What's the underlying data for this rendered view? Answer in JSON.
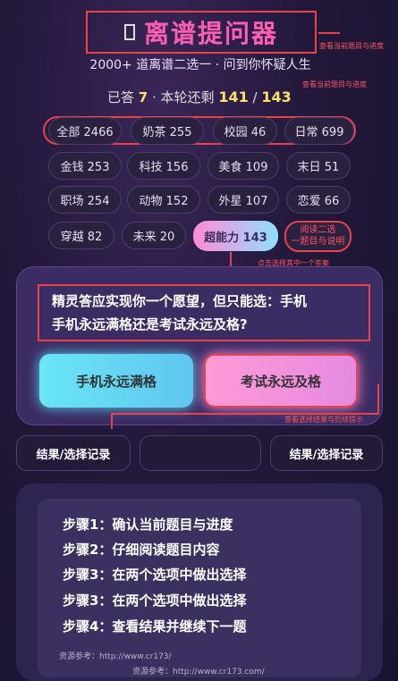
{
  "header": {
    "title_icon": "box-glyph-icon",
    "title": "离谱提问器",
    "subtitle": "2000+ 道离谱二选一 · 问到你怀疑人生"
  },
  "progress": {
    "answered_label": "已答",
    "answered": "7",
    "left_label": "· 本轮还剩",
    "left": "141",
    "sep": "/",
    "total": "143"
  },
  "annotations": {
    "a1": "查看当前题目与进度",
    "a2": "查看当前题目与进度",
    "a3": "点击选择其中一个答案",
    "a4": "查看选择结果与后续提示"
  },
  "tags": [
    {
      "label": "全部 2466"
    },
    {
      "label": "奶茶 255"
    },
    {
      "label": "校园 46"
    },
    {
      "label": "日常 699"
    },
    {
      "label": "金钱 253"
    },
    {
      "label": "科技 156"
    },
    {
      "label": "美食 109"
    },
    {
      "label": "末日 51"
    },
    {
      "label": "职场 254"
    },
    {
      "label": "动物 152"
    },
    {
      "label": "外星 107"
    },
    {
      "label": "恋爱 66"
    },
    {
      "label": "穿越 82"
    },
    {
      "label": "未来 20"
    },
    {
      "label": "超能力 143"
    }
  ],
  "help_tag": {
    "line1": "阅读二选",
    "line2": "一题目与说明"
  },
  "question": {
    "line1": "精灵答应实现你一个愿望，但只能选：手机",
    "line2": "手机永远满格还是考试永远及格?"
  },
  "choices": {
    "a": "手机永远满格",
    "b": "考试永远及格"
  },
  "results": {
    "left": "结果/选择记录",
    "middle": "",
    "right": "结果/选择记录"
  },
  "steps": [
    "步骤1：确认当前题目与进度",
    "步骤2：仔细阅读题目内容",
    "步骤3：在两个选项中做出选择",
    "步骤3：在两个选项中做出选择",
    "步骤4：查看结果并继续下一题"
  ],
  "refs": {
    "ref1": "资源参考：http://www.cr173/",
    "ref2": "资源参考：http://www.cr173.com/"
  },
  "colors": {
    "accent_pink": "#ff5fb3",
    "annotation_red": "#e8424a",
    "highlight_yellow": "#ffe066"
  }
}
